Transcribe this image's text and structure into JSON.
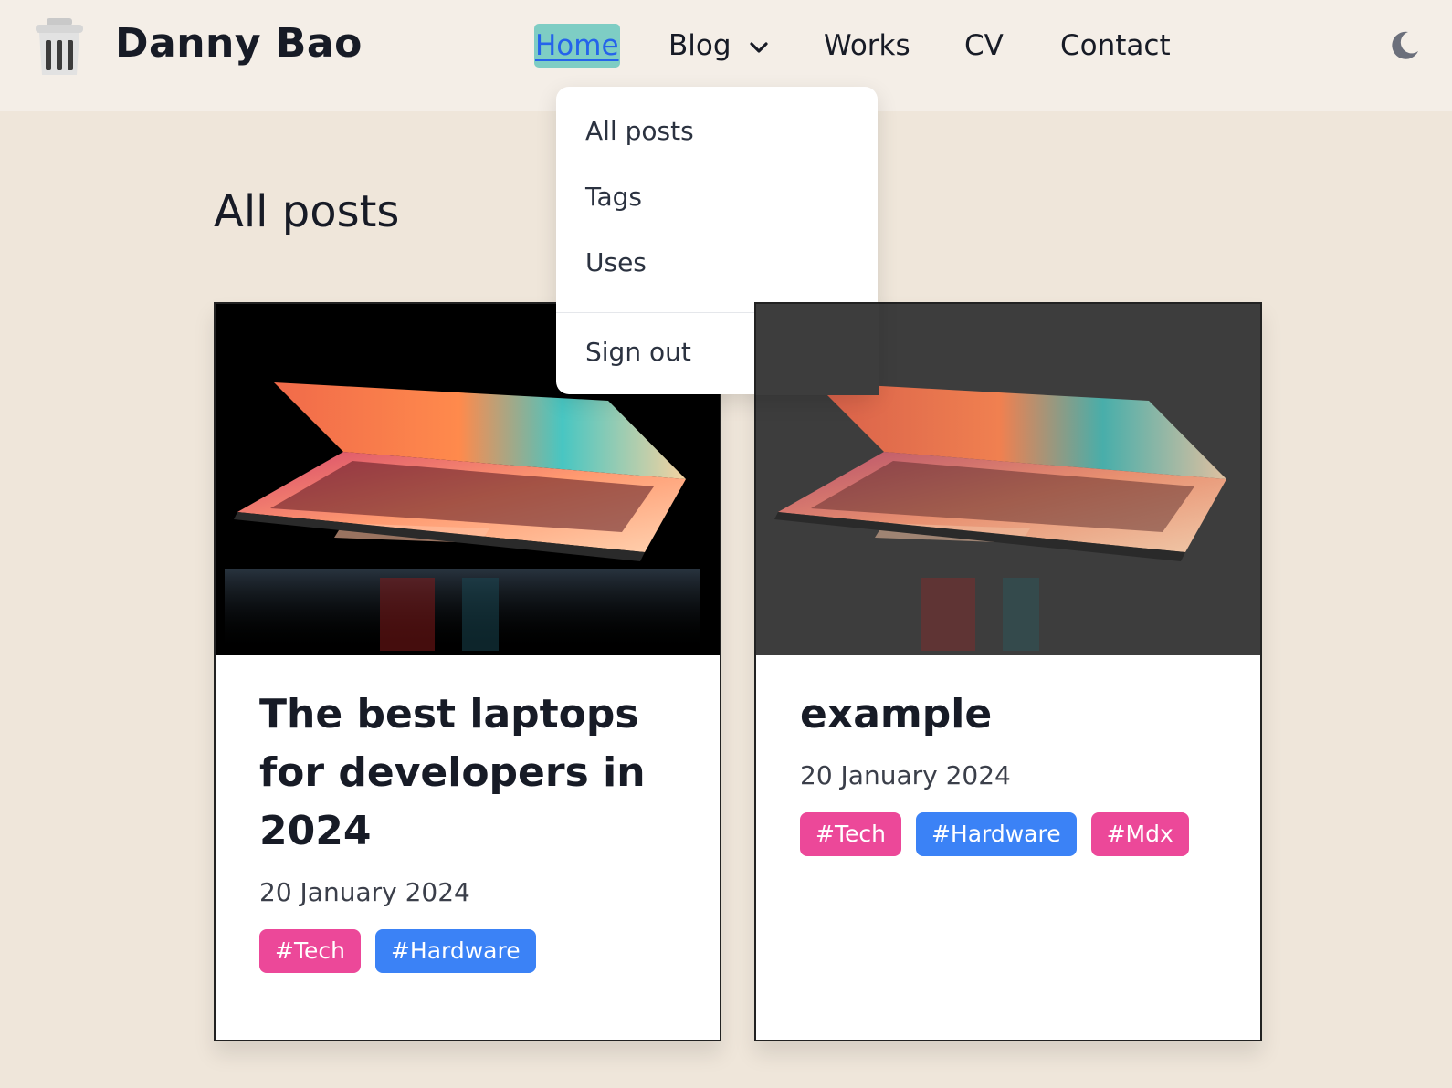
{
  "brand": {
    "name": "Danny Bao",
    "logo_icon": "trash-can-icon"
  },
  "nav": {
    "home": "Home",
    "blog": "Blog",
    "works": "Works",
    "cv": "CV",
    "contact": "Contact",
    "theme_icon": "moon-icon"
  },
  "blog_menu": {
    "all_posts": "All posts",
    "tags": "Tags",
    "uses": "Uses",
    "sign_out": "Sign out"
  },
  "page": {
    "title": "All posts"
  },
  "posts": [
    {
      "title": "The best laptops for developers in 2024",
      "date": "20 January 2024",
      "image": "laptop-photo",
      "tags": [
        "#Tech",
        "#Hardware"
      ]
    },
    {
      "title": "example",
      "date": "20 January 2024",
      "image": "laptop-photo",
      "tags": [
        "#Tech",
        "#Hardware",
        "#Mdx"
      ]
    }
  ],
  "colors": {
    "background": "#efe6da",
    "navbar": "#f4eee7",
    "active_nav_bg": "#7ecdc4",
    "active_nav_text": "#2563eb",
    "tag_tech": "#ec4899",
    "tag_hardware": "#3b82f6",
    "tag_mdx": "#ec4899"
  }
}
